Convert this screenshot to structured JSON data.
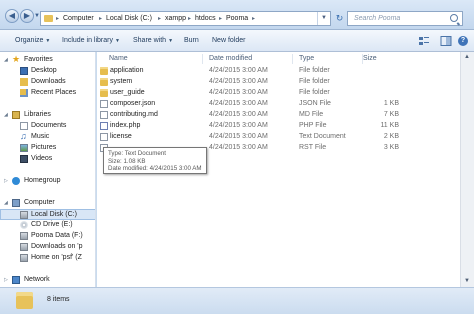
{
  "address_bar": {
    "crumbs": [
      "Computer",
      "Local Disk (C:)",
      "xampp",
      "htdocs",
      "Pooma"
    ]
  },
  "search": {
    "placeholder": "Search Pooma"
  },
  "toolbar": {
    "organize": "Organize",
    "include_in_library": "Include in library",
    "share_with": "Share with",
    "burn": "Burn",
    "new_folder": "New folder"
  },
  "nav": {
    "favorites": "Favorites",
    "desktop": "Desktop",
    "downloads": "Downloads",
    "recent_places": "Recent Places",
    "libraries": "Libraries",
    "documents": "Documents",
    "music": "Music",
    "pictures": "Pictures",
    "videos": "Videos",
    "homegroup": "Homegroup",
    "computer": "Computer",
    "local_disk": "Local Disk (C:)",
    "cd_drive": "CD Drive (E:)",
    "pooma_drive": "Pooma Data (F:)",
    "downloads_on": "Downloads on 'p",
    "home_on": "Home on 'psf' (Z",
    "network": "Network"
  },
  "columns": {
    "name": "Name",
    "date": "Date modified",
    "type": "Type",
    "size": "Size"
  },
  "files": [
    {
      "name": "application",
      "date": "4/24/2015 3:00 AM",
      "type": "File folder",
      "size": "",
      "kind": "folder"
    },
    {
      "name": "system",
      "date": "4/24/2015 3:00 AM",
      "type": "File folder",
      "size": "",
      "kind": "folder"
    },
    {
      "name": "user_guide",
      "date": "4/24/2015 3:00 AM",
      "type": "File folder",
      "size": "",
      "kind": "folder"
    },
    {
      "name": "composer.json",
      "date": "4/24/2015 3:00 AM",
      "type": "JSON File",
      "size": "1 KB",
      "kind": "file"
    },
    {
      "name": "contributing.md",
      "date": "4/24/2015 3:00 AM",
      "type": "MD File",
      "size": "7 KB",
      "kind": "file"
    },
    {
      "name": "index.php",
      "date": "4/24/2015 3:00 AM",
      "type": "PHP File",
      "size": "11 KB",
      "kind": "php"
    },
    {
      "name": "license",
      "date": "4/24/2015 3:00 AM",
      "type": "Text Document",
      "size": "2 KB",
      "kind": "file"
    },
    {
      "name": "",
      "date": "4/24/2015 3:00 AM",
      "type": "RST File",
      "size": "3 KB",
      "kind": "file"
    }
  ],
  "tooltip": {
    "type": "Type: Text Document",
    "size": "Size: 1.08 KB",
    "date": "Date modified: 4/24/2015 3:00 AM"
  },
  "status": {
    "items": "8 items"
  },
  "icons": {
    "back": "back-arrow-icon",
    "forward": "forward-arrow-icon",
    "refresh": "refresh-icon",
    "search": "search-icon",
    "folder": "folder-icon",
    "file": "file-icon"
  },
  "colors": {
    "folder": "#e6bd4d",
    "selection": "#d8e6f6"
  }
}
